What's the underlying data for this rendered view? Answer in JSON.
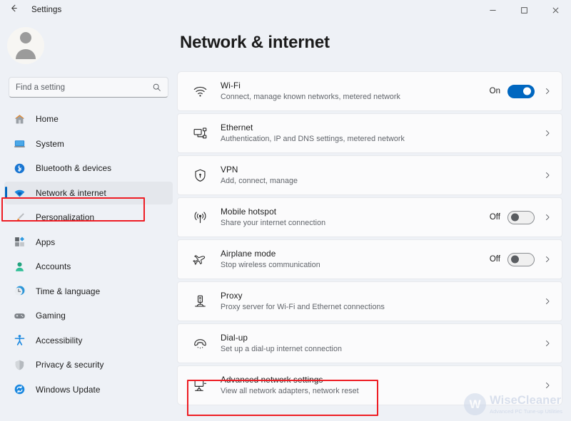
{
  "titlebar": {
    "back_icon": "arrow-left-icon",
    "title": "Settings",
    "minimize_label": "─",
    "maximize_label": "□",
    "close_label": "✕"
  },
  "sidebar": {
    "avatar_icon": "user-avatar-icon",
    "search": {
      "placeholder": "Find a setting",
      "value": "",
      "icon": "search-icon"
    },
    "items": [
      {
        "label": "Home",
        "icon": "home-icon",
        "selected": false
      },
      {
        "label": "System",
        "icon": "system-icon",
        "selected": false
      },
      {
        "label": "Bluetooth & devices",
        "icon": "bluetooth-icon",
        "selected": false
      },
      {
        "label": "Network & internet",
        "icon": "wifi-icon",
        "selected": true
      },
      {
        "label": "Personalization",
        "icon": "brush-icon",
        "selected": false
      },
      {
        "label": "Apps",
        "icon": "apps-icon",
        "selected": false
      },
      {
        "label": "Accounts",
        "icon": "accounts-icon",
        "selected": false
      },
      {
        "label": "Time & language",
        "icon": "clock-icon",
        "selected": false
      },
      {
        "label": "Gaming",
        "icon": "gamepad-icon",
        "selected": false
      },
      {
        "label": "Accessibility",
        "icon": "accessibility-icon",
        "selected": false
      },
      {
        "label": "Privacy & security",
        "icon": "shield-icon",
        "selected": false
      },
      {
        "label": "Windows Update",
        "icon": "update-icon",
        "selected": false
      }
    ]
  },
  "main": {
    "page_title": "Network & internet",
    "rows": [
      {
        "title": "Wi-Fi",
        "subtitle": "Connect, manage known networks, metered network",
        "icon": "wifi-icon",
        "toggle": {
          "present": true,
          "state": "On",
          "on": true
        },
        "chevron": "chevron-right-icon"
      },
      {
        "title": "Ethernet",
        "subtitle": "Authentication, IP and DNS settings, metered network",
        "icon": "ethernet-icon",
        "toggle": {
          "present": false,
          "state": "",
          "on": false
        },
        "chevron": "chevron-right-icon"
      },
      {
        "title": "VPN",
        "subtitle": "Add, connect, manage",
        "icon": "vpn-shield-icon",
        "toggle": {
          "present": false,
          "state": "",
          "on": false
        },
        "chevron": "chevron-right-icon"
      },
      {
        "title": "Mobile hotspot",
        "subtitle": "Share your internet connection",
        "icon": "hotspot-icon",
        "toggle": {
          "present": true,
          "state": "Off",
          "on": false
        },
        "chevron": "chevron-right-icon"
      },
      {
        "title": "Airplane mode",
        "subtitle": "Stop wireless communication",
        "icon": "airplane-icon",
        "toggle": {
          "present": true,
          "state": "Off",
          "on": false
        },
        "chevron": "chevron-right-icon"
      },
      {
        "title": "Proxy",
        "subtitle": "Proxy server for Wi-Fi and Ethernet connections",
        "icon": "proxy-icon",
        "toggle": {
          "present": false,
          "state": "",
          "on": false
        },
        "chevron": "chevron-right-icon"
      },
      {
        "title": "Dial-up",
        "subtitle": "Set up a dial-up internet connection",
        "icon": "dialup-icon",
        "toggle": {
          "present": false,
          "state": "",
          "on": false
        },
        "chevron": "chevron-right-icon"
      },
      {
        "title": "Advanced network settings",
        "subtitle": "View all network adapters, network reset",
        "icon": "advanced-network-icon",
        "toggle": {
          "present": false,
          "state": "",
          "on": false
        },
        "chevron": "chevron-right-icon"
      }
    ]
  },
  "watermark": {
    "badge": "W",
    "name": "WiseCleaner",
    "tagline": "Advanced PC Tune-up Utilities"
  },
  "colors": {
    "accent": "#0067c0",
    "annotation": "#ee1c23",
    "page_background": "#eef1f6",
    "card_background": "#fbfbfc"
  }
}
